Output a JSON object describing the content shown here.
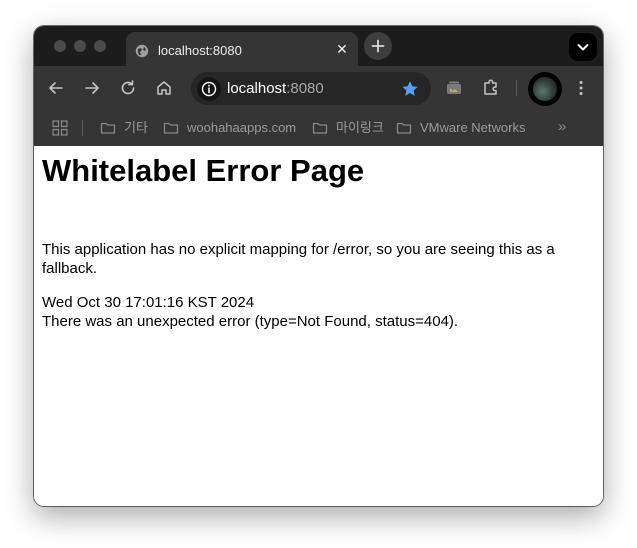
{
  "tab": {
    "title": "localhost:8080",
    "close": "✕"
  },
  "omnibox": {
    "host": "localhost",
    "port": ":8080"
  },
  "bookmarks": {
    "items": [
      {
        "label": "기타"
      },
      {
        "label": "woohahaapps.com"
      },
      {
        "label": "마이링크"
      },
      {
        "label": "VMware Networks"
      }
    ],
    "more": "»"
  },
  "page": {
    "heading": "Whitelabel Error Page",
    "message": "This application has no explicit mapping for /error, so you are seeing this as a fallback.",
    "timestamp": "Wed Oct 30 17:01:16 KST 2024",
    "error_detail": "There was an unexpected error (type=Not Found, status=404)."
  },
  "colors": {
    "accent_star": "#5b9cf6",
    "toolbar_bg": "#353535",
    "tabstrip_bg": "#1c1c1c"
  },
  "icons": {
    "back": "arrow-left-icon",
    "forward": "arrow-right-icon",
    "reload": "reload-icon",
    "home": "home-icon",
    "site_info": "info-icon",
    "bookmark": "star-icon",
    "media": "media-icon",
    "extensions": "puzzle-icon",
    "menu": "kebab-menu-icon",
    "apps": "apps-grid-icon",
    "folder": "folder-icon"
  }
}
